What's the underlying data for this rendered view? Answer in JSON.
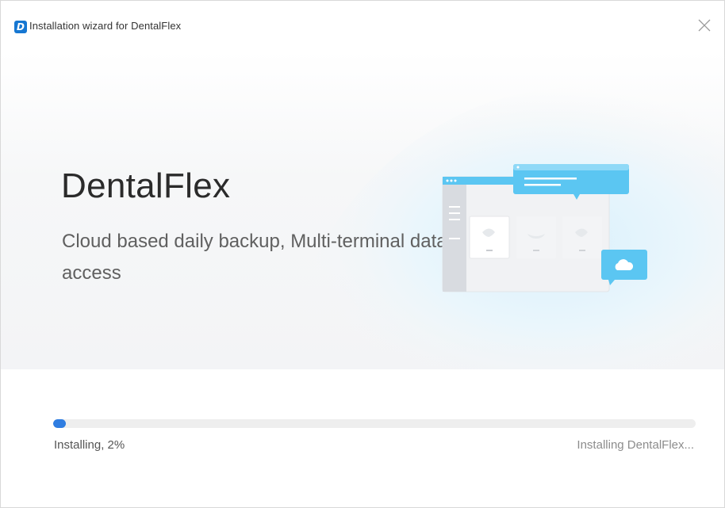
{
  "window": {
    "title": "Installation wizard for DentalFlex",
    "app_icon": "dentalflex-logo-icon",
    "app_icon_letter": "D",
    "close_icon": "close-icon"
  },
  "hero": {
    "product_name": "DentalFlex",
    "tagline": "Cloud based daily backup, Multi-terminal data access"
  },
  "progress": {
    "percent": 2,
    "status_left": "Installing, 2%",
    "status_right": "Installing DentalFlex..."
  },
  "colors": {
    "accent": "#2f7de1",
    "brand": "#1677d2",
    "illustration_blue": "#5bc6f2"
  }
}
